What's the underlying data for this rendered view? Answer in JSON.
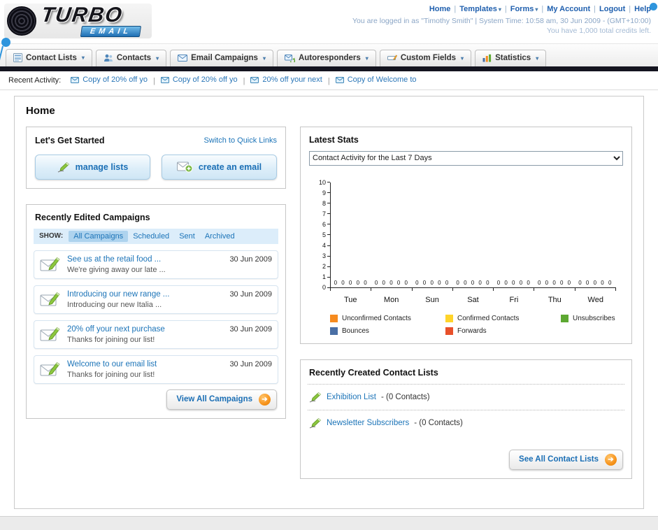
{
  "ui": {
    "caret": "▾",
    "separator": "|",
    "arrow": "➔"
  },
  "header": {
    "logo": {
      "line1": "TURBO",
      "line2": "EMAIL"
    },
    "top_links": [
      {
        "label": "Home",
        "dropdown": false
      },
      {
        "label": "Templates",
        "dropdown": true
      },
      {
        "label": "Forms",
        "dropdown": true
      },
      {
        "label": "My Account",
        "dropdown": false
      },
      {
        "label": "Logout",
        "dropdown": false
      },
      {
        "label": "Help",
        "dropdown": false
      }
    ],
    "login_line1": "You are logged in as \"Timothy Smith\" | System Time: 10:58 am, 30 Jun 2009 - (GMT+10:00)",
    "login_line2": "You have 1,000 total credits left."
  },
  "nav": {
    "tabs": [
      {
        "label": "Contact Lists",
        "icon": "contact-lists"
      },
      {
        "label": "Contacts",
        "icon": "contacts"
      },
      {
        "label": "Email Campaigns",
        "icon": "email-campaigns"
      },
      {
        "label": "Autoresponders",
        "icon": "autoresponders"
      },
      {
        "label": "Custom Fields",
        "icon": "custom-fields"
      },
      {
        "label": "Statistics",
        "icon": "statistics"
      }
    ]
  },
  "recent_activity": {
    "label": "Recent Activity:",
    "items": [
      "Copy of 20% off yo",
      "Copy of 20% off yo",
      "20% off your next",
      "Copy of Welcome to"
    ]
  },
  "main": {
    "title": "Home"
  },
  "get_started": {
    "title": "Let's Get Started",
    "switch_link": "Switch to Quick Links",
    "manage_lists_label": "manage lists",
    "create_email_label": "create an email"
  },
  "campaigns": {
    "title": "Recently Edited Campaigns",
    "show_label": "SHOW:",
    "filters": [
      "All Campaigns",
      "Scheduled",
      "Sent",
      "Archived"
    ],
    "active_filter": "All Campaigns",
    "items": [
      {
        "title": "See us at the retail food ...",
        "subtitle": "We're giving away our late ...",
        "date": "30 Jun 2009"
      },
      {
        "title": "Introducing our new range ...",
        "subtitle": "Introducing our new Italia ...",
        "date": "30 Jun 2009"
      },
      {
        "title": "20% off your next purchase",
        "subtitle": "Thanks for joining our list!",
        "date": "30 Jun 2009"
      },
      {
        "title": "Welcome to our email list",
        "subtitle": "Thanks for joining our list!",
        "date": "30 Jun 2009"
      }
    ],
    "view_all_label": "View All Campaigns"
  },
  "stats": {
    "title": "Latest Stats",
    "dropdown_value": "Contact Activity for the Last 7 Days"
  },
  "chart_data": {
    "type": "bar",
    "title": "Contact Activity for the Last 7 Days",
    "categories": [
      "Tue",
      "Mon",
      "Sun",
      "Sat",
      "Fri",
      "Thu",
      "Wed"
    ],
    "series": [
      {
        "name": "Unconfirmed Contacts",
        "color": "#f68b1f",
        "values": [
          0,
          0,
          0,
          0,
          0,
          0,
          0
        ]
      },
      {
        "name": "Confirmed Contacts",
        "color": "#ffd42a",
        "values": [
          0,
          0,
          0,
          0,
          0,
          0,
          0
        ]
      },
      {
        "name": "Unsubscribes",
        "color": "#5da832",
        "values": [
          0,
          0,
          0,
          0,
          0,
          0,
          0
        ]
      },
      {
        "name": "Bounces",
        "color": "#4a6fa5",
        "values": [
          0,
          0,
          0,
          0,
          0,
          0,
          0
        ]
      },
      {
        "name": "Forwards",
        "color": "#e8502a",
        "values": [
          0,
          0,
          0,
          0,
          0,
          0,
          0
        ]
      }
    ],
    "ylim": [
      0,
      10
    ],
    "y_ticks": [
      0,
      1,
      2,
      3,
      4,
      5,
      6,
      7,
      8,
      9,
      10
    ],
    "grid": false,
    "legend_position": "bottom"
  },
  "contact_lists": {
    "title": "Recently Created Contact Lists",
    "items": [
      {
        "name": "Exhibition List",
        "count_text": "- (0 Contacts)"
      },
      {
        "name": "Newsletter Subscribers",
        "count_text": "- (0 Contacts)"
      }
    ],
    "see_all_label": "See All Contact Lists"
  }
}
